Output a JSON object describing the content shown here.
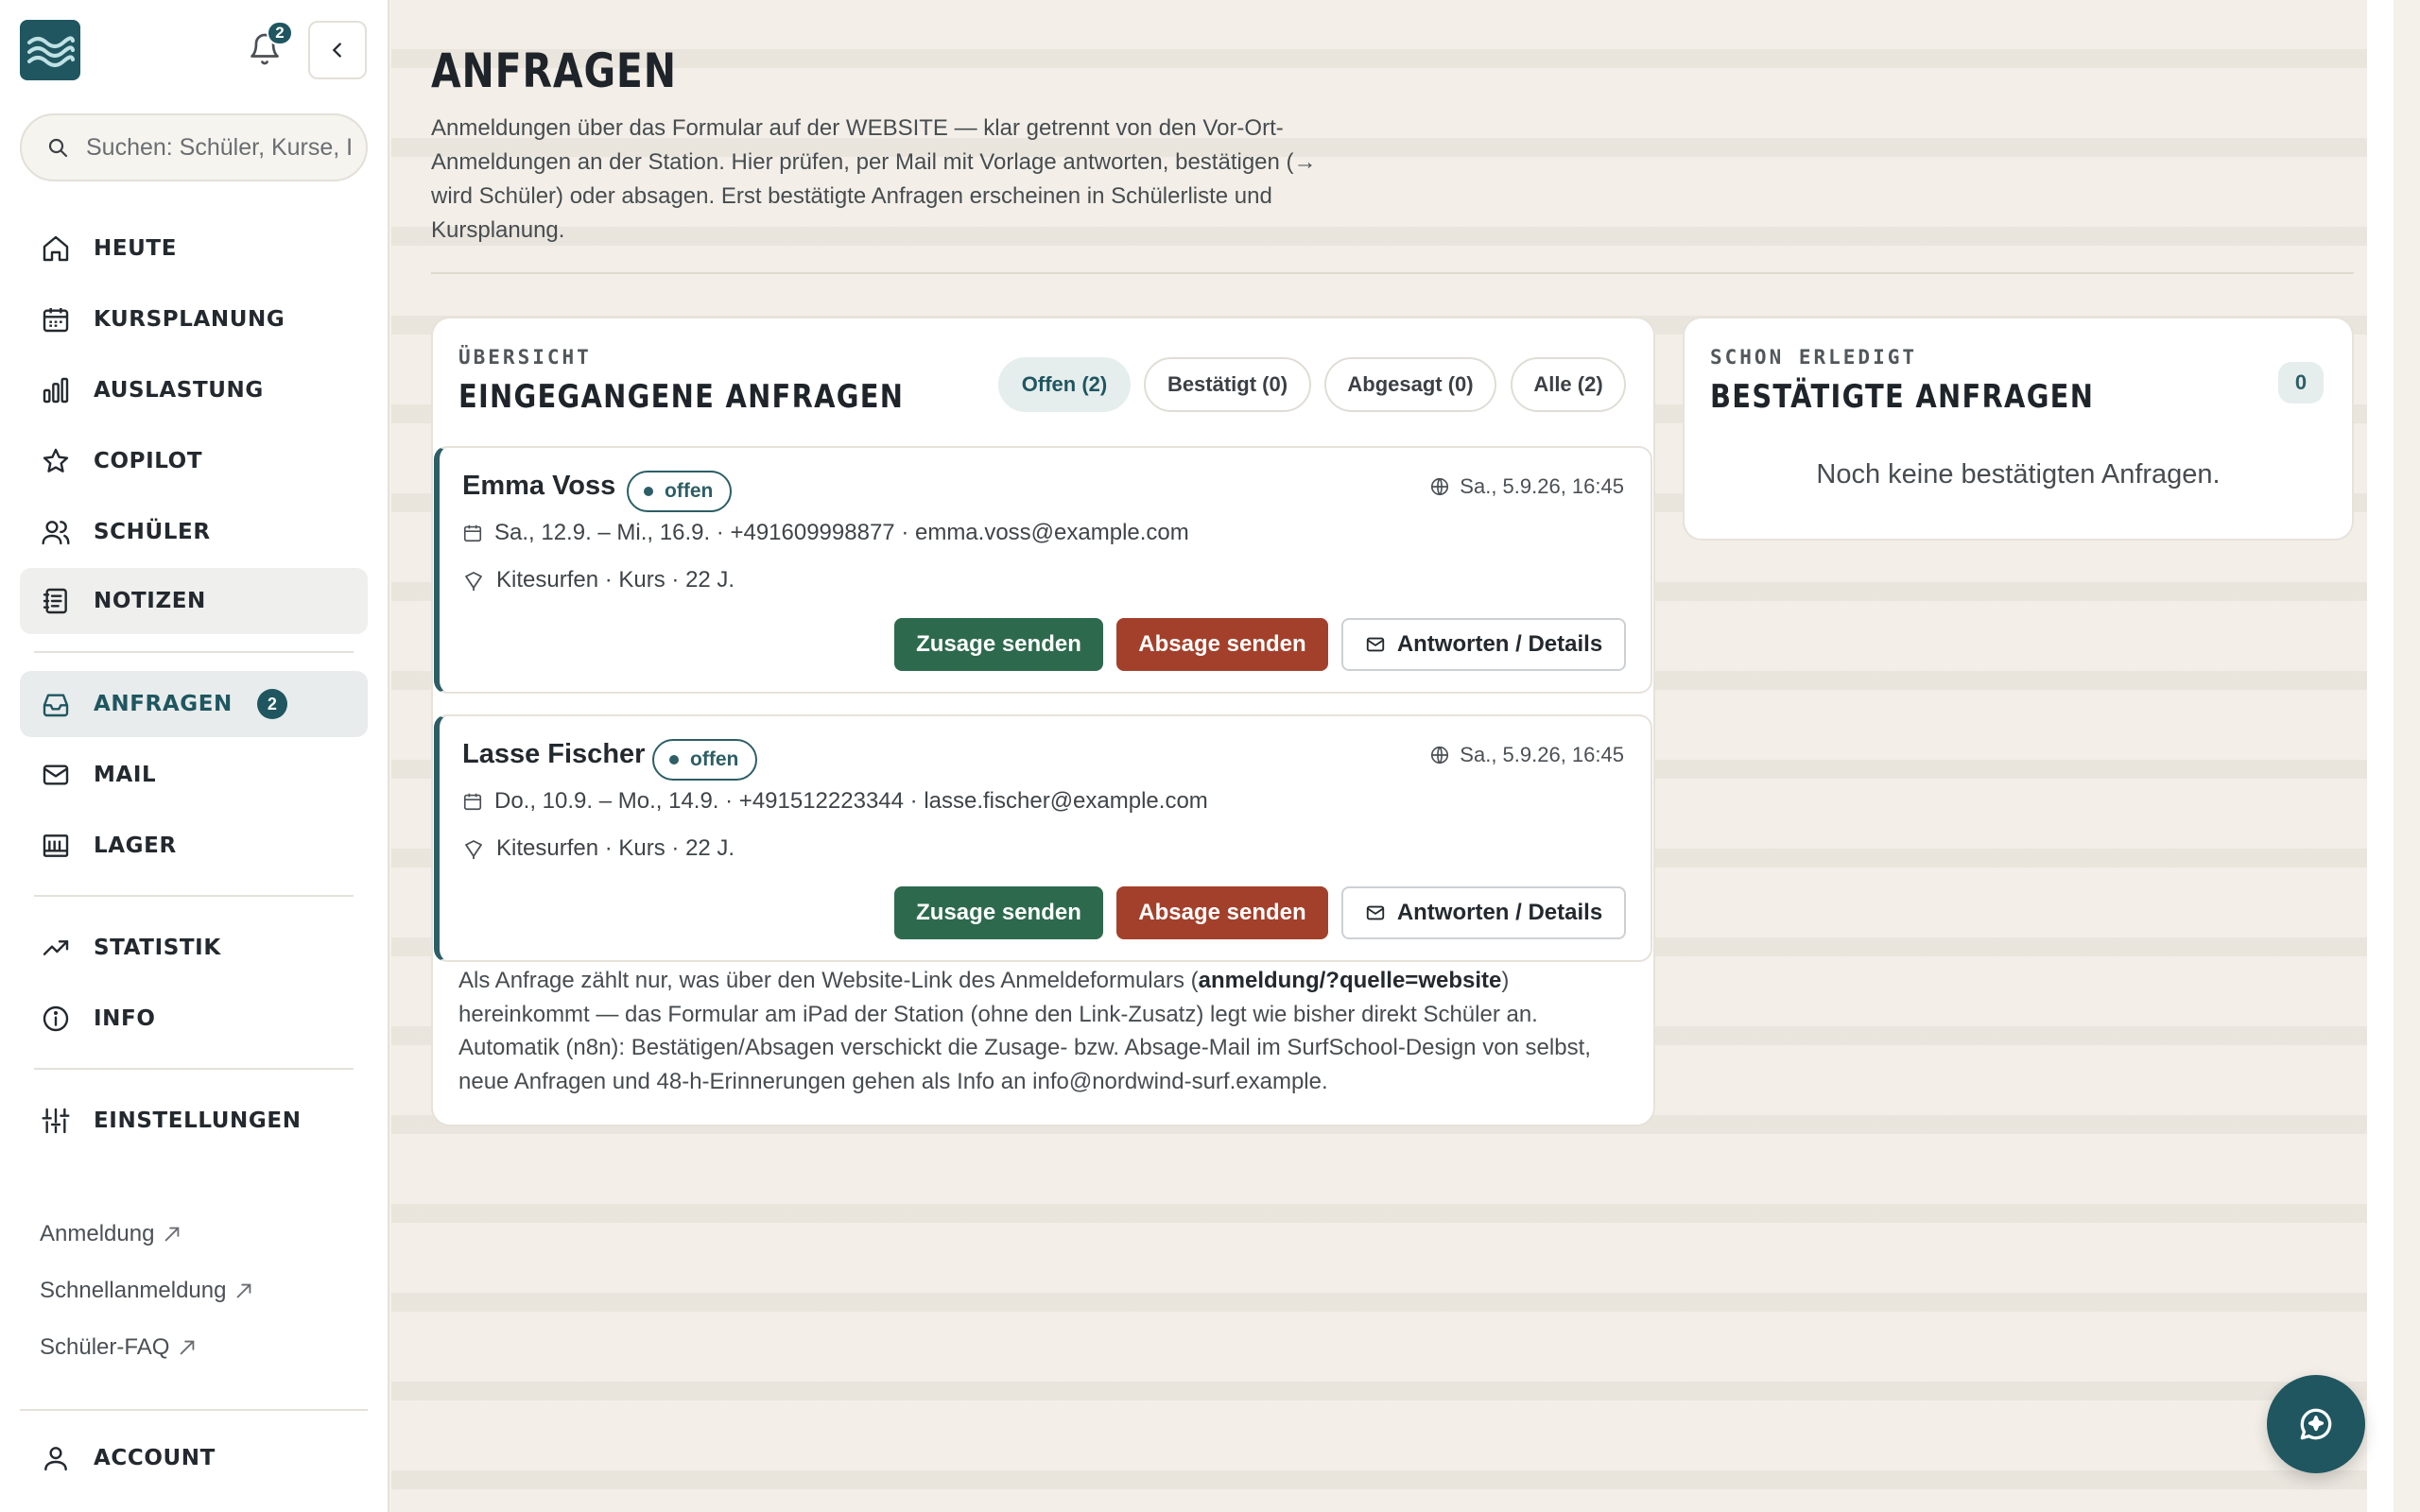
{
  "sidebar": {
    "notification_count": "2",
    "search_placeholder": "Suchen: Schüler, Kurse, I",
    "nav": [
      {
        "label": "HEUTE"
      },
      {
        "label": "KURSPLANUNG"
      },
      {
        "label": "AUSLASTUNG"
      },
      {
        "label": "COPILOT"
      },
      {
        "label": "SCHÜLER"
      },
      {
        "label": "NOTIZEN"
      },
      {
        "label": "ANFRAGEN",
        "badge": "2"
      },
      {
        "label": "MAIL"
      },
      {
        "label": "LAGER"
      },
      {
        "label": "STATISTIK"
      },
      {
        "label": "INFO"
      },
      {
        "label": "EINSTELLUNGEN"
      }
    ],
    "external_links": [
      "Anmeldung",
      "Schnellanmeldung",
      "Schüler-FAQ"
    ],
    "account_label": "ACCOUNT"
  },
  "page": {
    "title": "ANFRAGEN",
    "description": "Anmeldungen über das Formular auf der WEBSITE — klar getrennt von den Vor-Ort-Anmeldungen an der Station. Hier prüfen, per Mail mit Vorlage antworten, bestätigen (→ wird Schüler) oder absagen. Erst bestätigte Anfragen erscheinen in Schülerliste und Kursplanung."
  },
  "incoming": {
    "eyebrow": "ÜBERSICHT",
    "title": "EINGEGANGENE ANFRAGEN",
    "filters": [
      "Offen (2)",
      "Bestätigt (0)",
      "Abgesagt (0)",
      "Alle (2)"
    ],
    "active_filter": "Offen (2)",
    "requests": [
      {
        "name": "Emma Voss",
        "status": "offen",
        "received": "Sa., 5.9.26, 16:45",
        "details": "Sa., 12.9. – Mi., 16.9. · +491609998877 · emma.voss@example.com",
        "course": "Kitesurfen · Kurs · 22 J."
      },
      {
        "name": "Lasse Fischer",
        "status": "offen",
        "received": "Sa., 5.9.26, 16:45",
        "details": "Do., 10.9. – Mo., 14.9. · +491512223344 · lasse.fischer@example.com",
        "course": "Kitesurfen · Kurs · 22 J."
      }
    ],
    "buttons": {
      "accept": "Zusage senden",
      "decline": "Absage senden",
      "details": "Antworten / Details"
    },
    "footnote": {
      "part1": "Als Anfrage zählt nur, was über den Website-Link des Anmeldeformulars (",
      "bold": "anmeldung/?quelle=website",
      "part2": ") hereinkommt — das Formular am iPad der Station (ohne den Link-Zusatz) legt wie bisher direkt Schüler an. Automatik (n8n): Bestätigen/Absagen verschickt die Zusage- bzw. Absage-Mail im SurfSchool-Design von selbst, neue Anfragen und 48-h-Erinnerungen gehen als Info an info@nordwind-surf.example."
    }
  },
  "confirmed": {
    "eyebrow": "SCHON ERLEDIGT",
    "title": "BESTÄTIGTE ANFRAGEN",
    "count": "0",
    "empty_text": "Noch keine bestätigten Anfragen."
  },
  "colors": {
    "brand": "#1f5660",
    "accept": "#2d6a4d",
    "decline": "#a3402b"
  }
}
